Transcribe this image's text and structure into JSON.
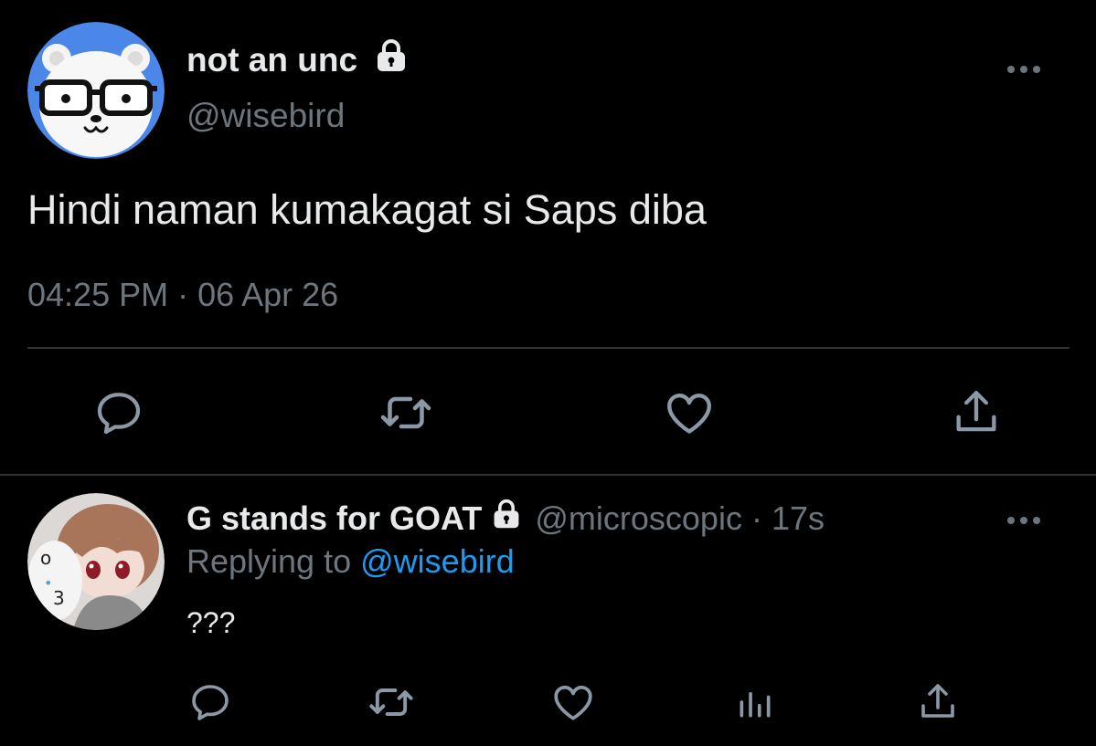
{
  "main_tweet": {
    "display_name": "not an unc",
    "handle": "@wisebird",
    "text": "Hindi naman kumakagat si Saps diba",
    "timestamp": "04:25 PM · 06 Apr 26",
    "avatar_icon": "polar-bear-glasses-avatar",
    "actions": [
      "reply-icon",
      "retweet-icon",
      "like-icon",
      "share-icon"
    ]
  },
  "reply_tweet": {
    "display_name": "G stands for GOAT",
    "handle": "@microscopic",
    "separator": "·",
    "time_ago": "17s",
    "replying_prefix": "Replying to",
    "replying_to": "@wisebird",
    "text": "???",
    "avatar_icon": "anime-figure-avatar",
    "actions": [
      "reply-icon",
      "retweet-icon",
      "like-icon",
      "analytics-icon",
      "share-icon"
    ]
  },
  "colors": {
    "background": "#000000",
    "primary_text": "#e7e9ea",
    "secondary_text": "#6e767d",
    "link": "#1d9bf0",
    "divider": "#2f3336",
    "icon": "#8b98a5",
    "avatar_blue": "#4a87e8"
  }
}
